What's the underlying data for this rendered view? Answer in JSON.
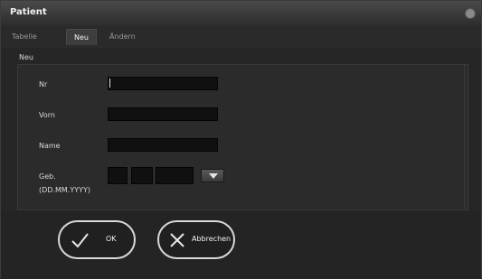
{
  "window": {
    "title": "Patient"
  },
  "tabs": [
    {
      "label": "Tabelle"
    },
    {
      "label": "Neu"
    },
    {
      "label": "Ändern"
    }
  ],
  "form": {
    "section_label": "Neu",
    "fields": {
      "nr": {
        "label": "Nr",
        "value": ""
      },
      "vorname": {
        "label": "Vorn",
        "value": ""
      },
      "name": {
        "label": "Name",
        "value": ""
      },
      "geb": {
        "label": "Geb.",
        "format": "(DD.MM.YYYY)"
      }
    }
  },
  "buttons": {
    "ok": {
      "label": "OK"
    },
    "abbrechen": {
      "label": "Abbrechen"
    }
  },
  "icons": {
    "close": "close-icon",
    "calendar": "chevron-down-icon",
    "ok": "check-icon",
    "cancel": "x-icon"
  }
}
